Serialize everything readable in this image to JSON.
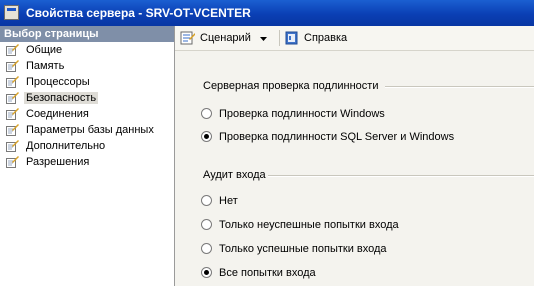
{
  "window": {
    "title": "Свойства сервера - SRV-OT-VCENTER"
  },
  "sidebar": {
    "header": "Выбор страницы",
    "items": [
      {
        "label": "Общие",
        "selected": false
      },
      {
        "label": "Память",
        "selected": false
      },
      {
        "label": "Процессоры",
        "selected": false
      },
      {
        "label": "Безопасность",
        "selected": true
      },
      {
        "label": "Соединения",
        "selected": false
      },
      {
        "label": "Параметры базы данных",
        "selected": false
      },
      {
        "label": "Дополнительно",
        "selected": false
      },
      {
        "label": "Разрешения",
        "selected": false
      }
    ]
  },
  "toolbar": {
    "script_label": "Сценарий",
    "help_label": "Справка"
  },
  "security": {
    "auth_title": "Серверная проверка подлинности",
    "auth_options": [
      {
        "label": "Проверка подлинности Windows",
        "checked": false
      },
      {
        "label": "Проверка подлинности SQL Server и Windows",
        "checked": true
      }
    ],
    "audit_title": "Аудит входа",
    "audit_options": [
      {
        "label": "Нет",
        "checked": false
      },
      {
        "label": "Только неуспешные попытки входа",
        "checked": false
      },
      {
        "label": "Только успешные попытки входа",
        "checked": false
      },
      {
        "label": "Все попытки входа",
        "checked": true
      }
    ]
  }
}
